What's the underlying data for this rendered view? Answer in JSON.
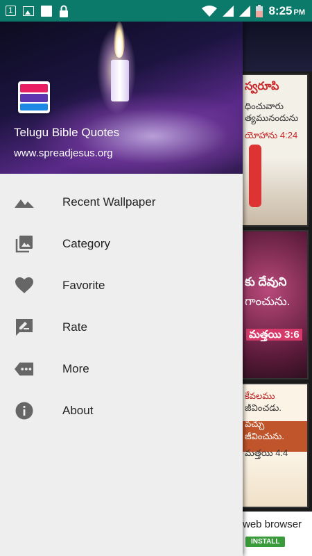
{
  "status_bar": {
    "sim_label": "1",
    "time": "8:25",
    "ampm": "PM"
  },
  "drawer": {
    "header": {
      "app_name": "Telugu Bible Quotes",
      "website": "www.spreadjesus.org"
    },
    "menu": [
      {
        "label": "Recent Wallpaper",
        "icon": "landscape-icon"
      },
      {
        "label": "Category",
        "icon": "photo-library-icon"
      },
      {
        "label": "Favorite",
        "icon": "heart-icon"
      },
      {
        "label": "Rate",
        "icon": "rate-review-icon"
      },
      {
        "label": "More",
        "icon": "more-label-icon"
      },
      {
        "label": "About",
        "icon": "info-icon"
      }
    ]
  },
  "background": {
    "cards": [
      {
        "title": "స్వరూపి",
        "line1": "ధించువారు",
        "line2": "త్యమునందును",
        "ref": "యోహాను 4:24"
      },
      {
        "line1": "కు దేవుని",
        "line2": "గాంచును.",
        "ref": "మత్తయి 3:6"
      },
      {
        "line1": "కేవలము",
        "line2": "జీవించడు.",
        "line3": "వచ్చు",
        "line4": "జీవించును.",
        "ref": "మత్తయి 4:4"
      }
    ],
    "ad": {
      "text": "web browser",
      "install_label": "INSTALL"
    }
  }
}
